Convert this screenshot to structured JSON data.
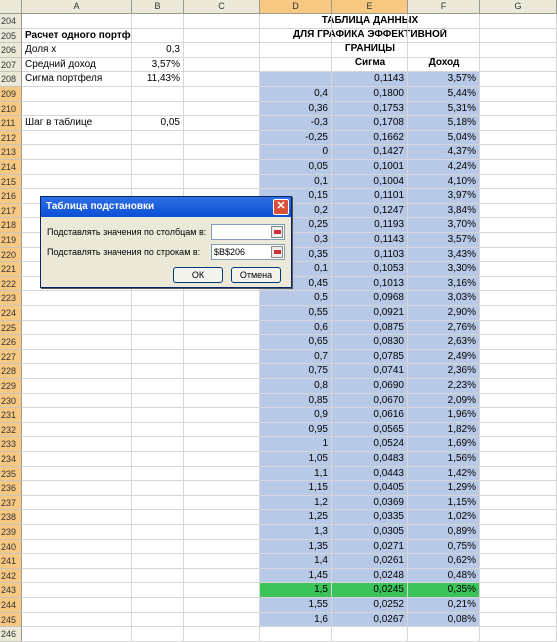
{
  "columns": [
    "A",
    "B",
    "C",
    "D",
    "E",
    "F",
    "G"
  ],
  "left_rows": [
    {
      "num": "204",
      "a": "",
      "b": ""
    },
    {
      "num": "205",
      "a": "Расчет одного портфеля",
      "b": "",
      "bold": true
    },
    {
      "num": "206",
      "a": "Доля х",
      "b": "0,3"
    },
    {
      "num": "207",
      "a": "Средний доход",
      "b": "3,57%"
    },
    {
      "num": "208",
      "a": "Сигма портфеля",
      "b": "11,43%"
    },
    {
      "num": "209",
      "a": "",
      "b": ""
    },
    {
      "num": "210",
      "a": "",
      "b": ""
    },
    {
      "num": "211",
      "a": "Шаг в таблице",
      "b": "0,05"
    }
  ],
  "table_header": {
    "line1": "ТАБЛИЦА ДАННЫХ",
    "line2": "ДЛЯ ГРАФИКА ЭФФЕКТИВНОЙ",
    "line3": "ГРАНИЦЫ",
    "col_sigma": "Сигма",
    "col_income": "Доход"
  },
  "data_rows": [
    {
      "num": "208",
      "d": "",
      "e": "0,1143",
      "f": "3,57%"
    },
    {
      "num": "209",
      "d": "0,4",
      "e": "0,1800",
      "f": "5,44%"
    },
    {
      "num": "210",
      "d": "0,36",
      "e": "0,1753",
      "f": "5,31%"
    },
    {
      "num": "211",
      "d": "-0,3",
      "e": "0,1708",
      "f": "5,18%"
    },
    {
      "num": "212",
      "d": "-0,25",
      "e": "0,1662",
      "f": "5,04%"
    },
    {
      "num": "213",
      "d": "0",
      "e": "0,1427",
      "f": "4,37%"
    },
    {
      "num": "214",
      "d": "0,05",
      "e": "0,1001",
      "f": "4,24%"
    },
    {
      "num": "215",
      "d": "0,1",
      "e": "0,1004",
      "f": "4,10%"
    },
    {
      "num": "216",
      "d": "0,15",
      "e": "0,1101",
      "f": "3,97%"
    },
    {
      "num": "217",
      "d": "0,2",
      "e": "0,1247",
      "f": "3,84%"
    },
    {
      "num": "218",
      "d": "0,25",
      "e": "0,1193",
      "f": "3,70%"
    },
    {
      "num": "219",
      "d": "0,3",
      "e": "0,1143",
      "f": "3,57%"
    },
    {
      "num": "220",
      "d": "0,35",
      "e": "0,1103",
      "f": "3,43%"
    },
    {
      "num": "221",
      "d": "0,1",
      "e": "0,1053",
      "f": "3,30%"
    },
    {
      "num": "222",
      "d": "0,45",
      "e": "0,1013",
      "f": "3,16%"
    },
    {
      "num": "223",
      "d": "0,5",
      "e": "0,0968",
      "f": "3,03%"
    },
    {
      "num": "224",
      "d": "0,55",
      "e": "0,0921",
      "f": "2,90%"
    },
    {
      "num": "225",
      "d": "0,6",
      "e": "0,0875",
      "f": "2,76%"
    },
    {
      "num": "226",
      "d": "0,65",
      "e": "0,0830",
      "f": "2,63%"
    },
    {
      "num": "227",
      "d": "0,7",
      "e": "0,0785",
      "f": "2,49%"
    },
    {
      "num": "228",
      "d": "0,75",
      "e": "0,0741",
      "f": "2,36%"
    },
    {
      "num": "229",
      "d": "0,8",
      "e": "0,0690",
      "f": "2,23%"
    },
    {
      "num": "230",
      "d": "0,85",
      "e": "0,0670",
      "f": "2,09%"
    },
    {
      "num": "231",
      "d": "0,9",
      "e": "0,0616",
      "f": "1,96%"
    },
    {
      "num": "232",
      "d": "0,95",
      "e": "0,0565",
      "f": "1,82%"
    },
    {
      "num": "233",
      "d": "1",
      "e": "0,0524",
      "f": "1,69%"
    },
    {
      "num": "234",
      "d": "1,05",
      "e": "0,0483",
      "f": "1,56%"
    },
    {
      "num": "235",
      "d": "1,1",
      "e": "0,0443",
      "f": "1,42%"
    },
    {
      "num": "236",
      "d": "1,15",
      "e": "0,0405",
      "f": "1,29%"
    },
    {
      "num": "237",
      "d": "1,2",
      "e": "0,0369",
      "f": "1,15%"
    },
    {
      "num": "238",
      "d": "1,25",
      "e": "0,0335",
      "f": "1,02%"
    },
    {
      "num": "239",
      "d": "1,3",
      "e": "0,0305",
      "f": "0,89%"
    },
    {
      "num": "240",
      "d": "1,35",
      "e": "0,0271",
      "f": "0,75%"
    },
    {
      "num": "241",
      "d": "1,4",
      "e": "0,0261",
      "f": "0,62%"
    },
    {
      "num": "242",
      "d": "1,45",
      "e": "0,0248",
      "f": "0,48%"
    },
    {
      "num": "243",
      "d": "1,5",
      "e": "0,0245",
      "f": "0,35%",
      "highlight": true
    },
    {
      "num": "244",
      "d": "1,55",
      "e": "0,0252",
      "f": "0,21%"
    },
    {
      "num": "245",
      "d": "1,6",
      "e": "0,0267",
      "f": "0,08%"
    }
  ],
  "dialog": {
    "title": "Таблица подстановки",
    "close": "✕",
    "label_cols": "Подставлять значения по столбцам в:",
    "label_rows": "Подставлять значения по строкам в:",
    "value_cols": "",
    "value_rows": "$B$206",
    "ok": "ОК",
    "cancel": "Отмена"
  }
}
